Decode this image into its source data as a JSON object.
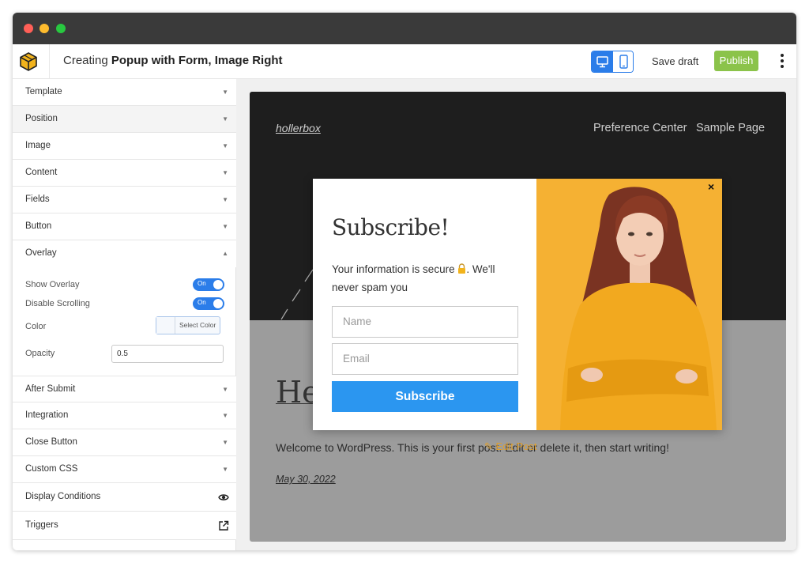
{
  "window": {
    "controls": [
      "close",
      "minimize",
      "maximize"
    ]
  },
  "header": {
    "title_prefix": "Creating",
    "title_name": "Popup with Form, Image Right",
    "save_draft_label": "Save draft",
    "publish_label": "Publish",
    "active_device": "desktop"
  },
  "sidebar": {
    "sections": [
      {
        "label": "Template"
      },
      {
        "label": "Position"
      },
      {
        "label": "Image"
      },
      {
        "label": "Content"
      },
      {
        "label": "Fields"
      },
      {
        "label": "Button"
      },
      {
        "label": "Overlay"
      },
      {
        "label": "After Submit"
      },
      {
        "label": "Integration"
      },
      {
        "label": "Close Button"
      },
      {
        "label": "Custom CSS"
      },
      {
        "label": "Display Conditions"
      },
      {
        "label": "Triggers"
      }
    ],
    "overlay": {
      "show_overlay_label": "Show Overlay",
      "show_overlay_state": "On",
      "disable_scrolling_label": "Disable Scrolling",
      "disable_scrolling_state": "On",
      "color_label": "Color",
      "select_color_label": "Select Color",
      "opacity_label": "Opacity",
      "opacity_value": "0.5"
    }
  },
  "preview": {
    "site_brand": "hollerbox",
    "nav": [
      "Preference Center",
      "Sample Page"
    ],
    "post_title": "He",
    "post_excerpt": "Welcome to WordPress. This is your first post. Edit or delete it, then start writing!",
    "edit_link": "Edit Post",
    "post_date": "May 30, 2022",
    "popup": {
      "close_glyph": "×",
      "heading": "Subscribe!",
      "body_part1": "Your information is secure",
      "body_part2": ". We'll never spam you",
      "name_placeholder": "Name",
      "email_placeholder": "Email",
      "submit_label": "Subscribe"
    }
  },
  "colors": {
    "accent_blue": "#2b7de9",
    "publish_green": "#8bc34a",
    "popup_button": "#2b96f0",
    "popup_image_bg": "#f5b133",
    "site_header": "#1e1e1e",
    "overlay_gray": "#9c9c9c"
  }
}
